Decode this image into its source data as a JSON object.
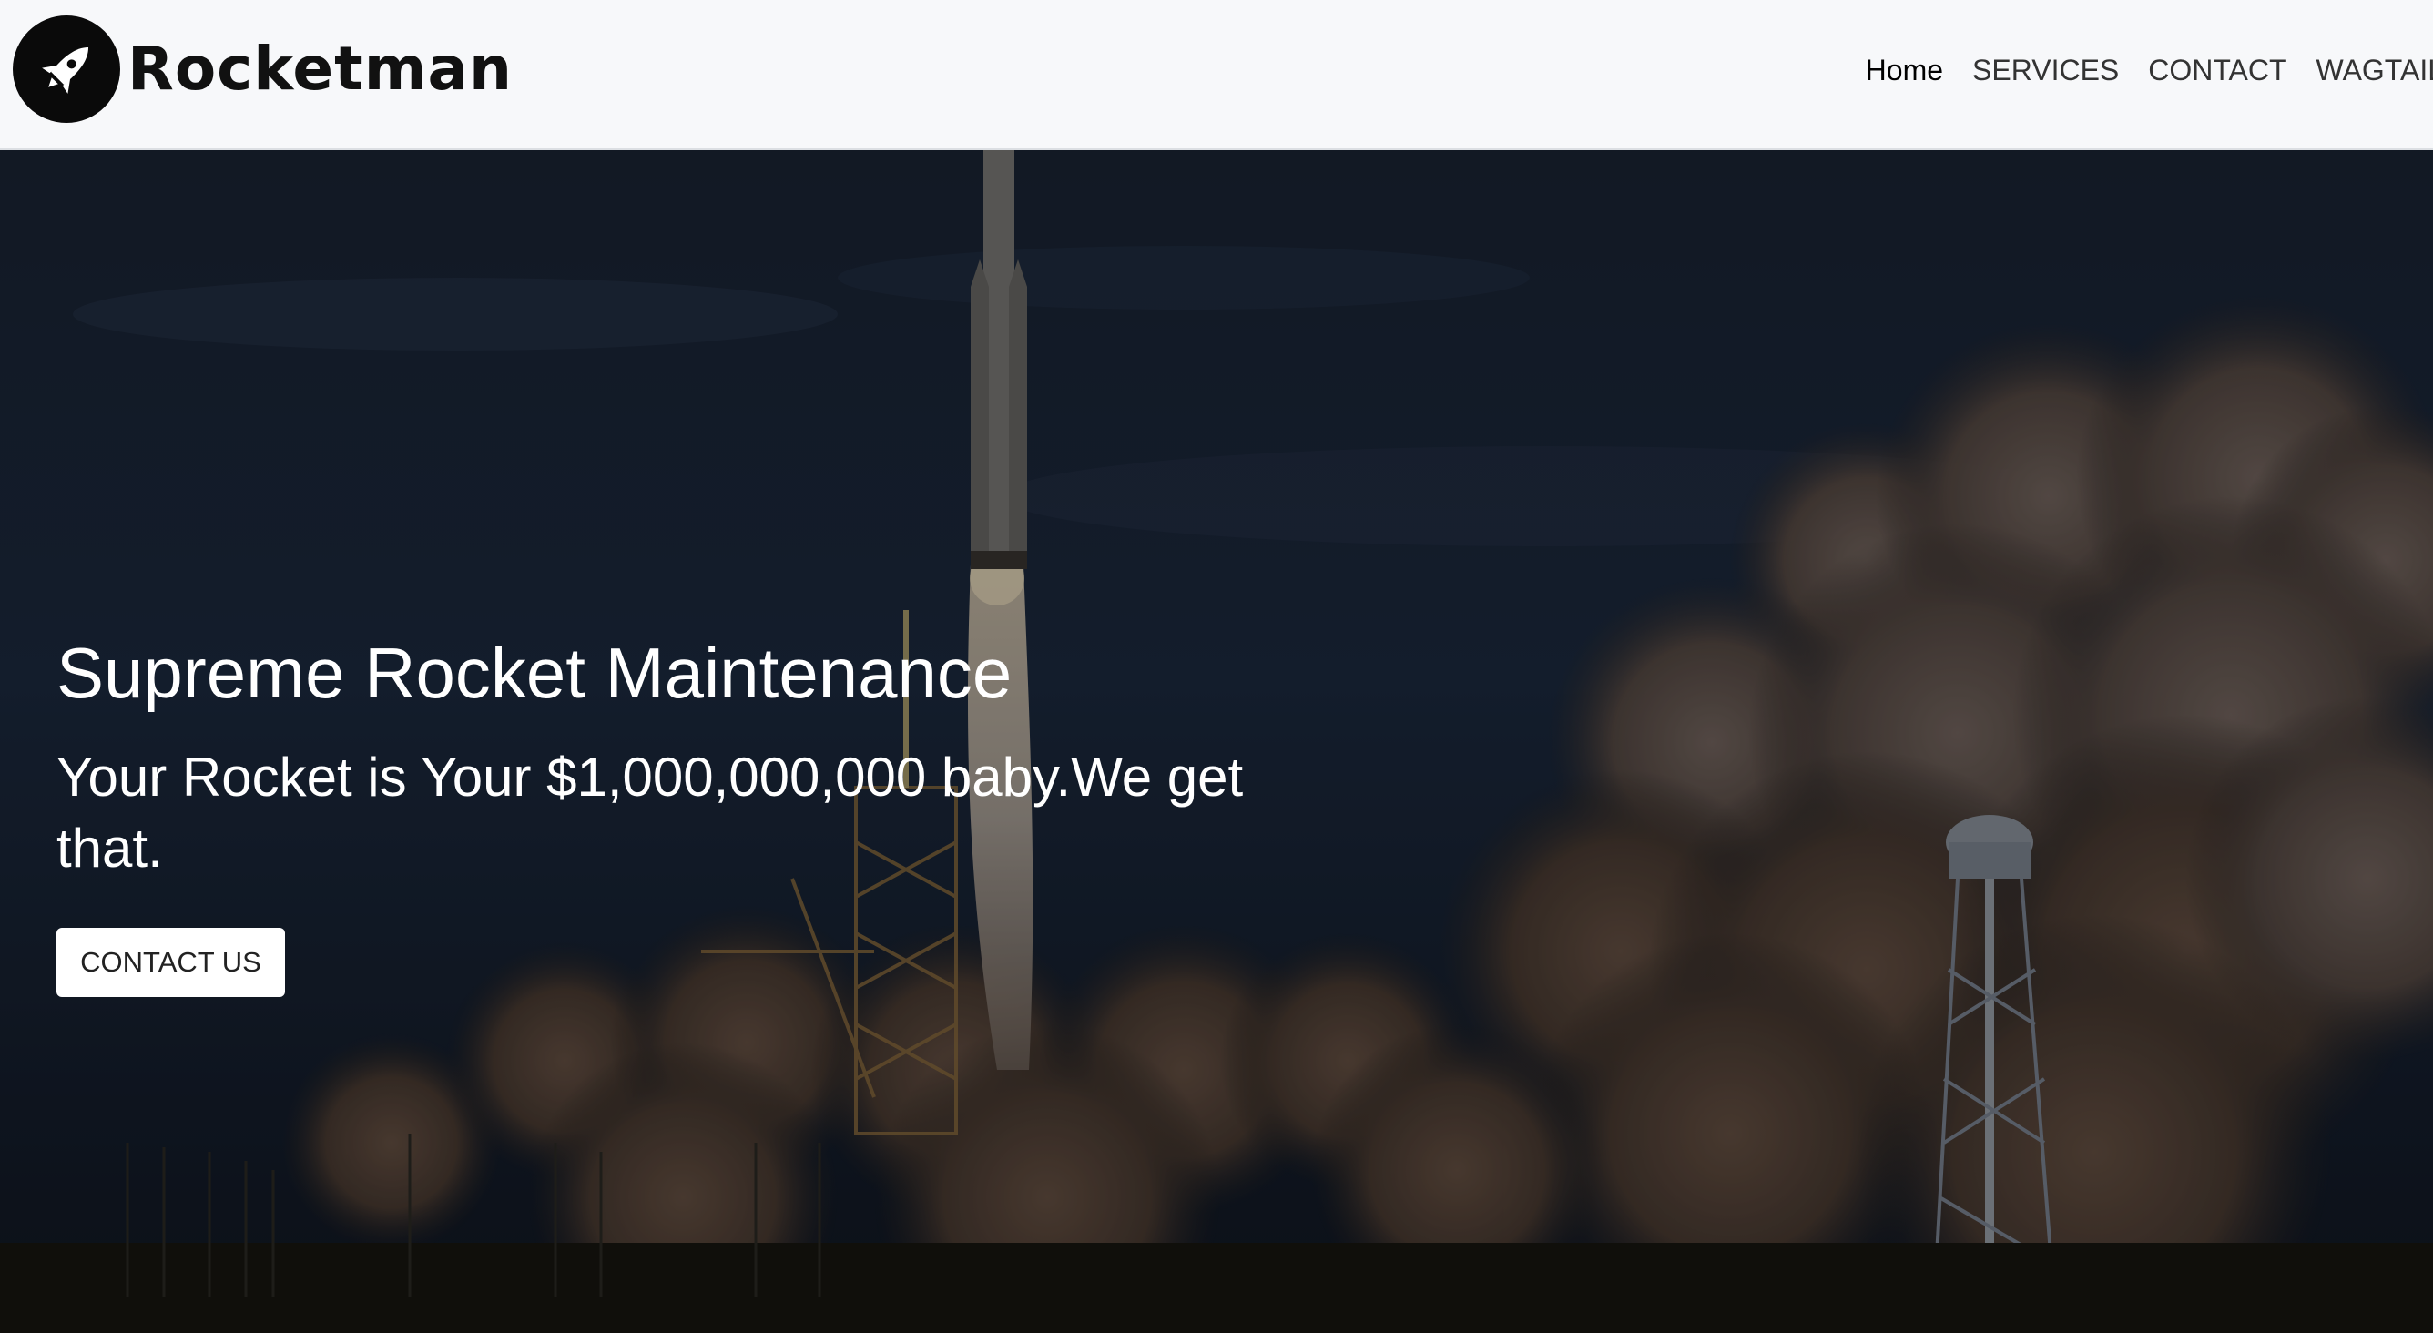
{
  "brand": {
    "name": "Rocketman",
    "logo_icon": "rocket-icon"
  },
  "nav": {
    "items": [
      {
        "label": "Home",
        "active": true
      },
      {
        "label": "SERVICES",
        "active": false
      },
      {
        "label": "CONTACT",
        "active": false
      },
      {
        "label": "WAGTAIL",
        "active": false
      }
    ]
  },
  "hero": {
    "title": "Supreme Rocket Maintenance",
    "subtitle": "Your Rocket is Your $1,000,000,000 baby.We get that.",
    "cta_label": "CONTACT US",
    "background": "rocket launch photo with smoke clouds, darkened overlay"
  },
  "colors": {
    "navbar_bg": "#f7f8fa",
    "hero_text": "#ffffff",
    "button_bg": "#ffffff",
    "sky_dark": "#18263a"
  }
}
